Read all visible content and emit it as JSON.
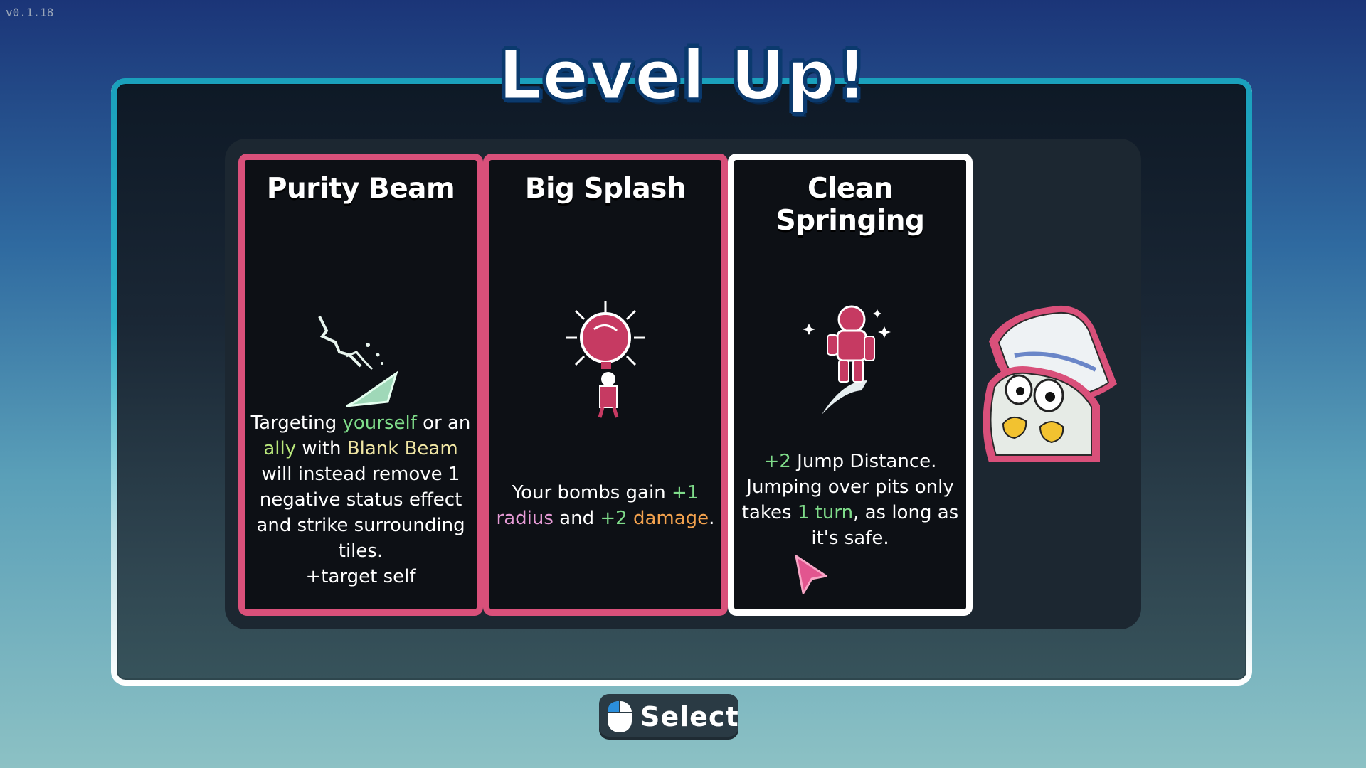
{
  "version": "v0.1.18",
  "title": "Level Up!",
  "cards": [
    {
      "name": "Purity Beam",
      "icon": "beam-icon",
      "desc": [
        {
          "text": "Targeting ",
          "c": ""
        },
        {
          "text": "yourself",
          "c": "green"
        },
        {
          "text": " or an ",
          "c": ""
        },
        {
          "text": "ally",
          "c": "lime"
        },
        {
          "text": " with ",
          "c": ""
        },
        {
          "text": "Blank Beam",
          "c": "cream"
        },
        {
          "text": " will instead remove 1 negative status effect and strike surrounding tiles.",
          "c": ""
        }
      ],
      "extra": "+target self",
      "selected": false
    },
    {
      "name": "Big Splash",
      "icon": "bomb-icon",
      "desc": [
        {
          "text": "Your bombs gain ",
          "c": ""
        },
        {
          "text": "+1 ",
          "c": "green"
        },
        {
          "text": "radius",
          "c": "pink"
        },
        {
          "text": " and ",
          "c": ""
        },
        {
          "text": "+2 ",
          "c": "green"
        },
        {
          "text": "damage",
          "c": "orange"
        },
        {
          "text": ".",
          "c": ""
        }
      ],
      "selected": false
    },
    {
      "name": "Clean Springing",
      "icon": "spring-jump-icon",
      "desc": [
        {
          "text": "+2",
          "c": "green"
        },
        {
          "text": " Jump Distance. Jumping over pits only takes ",
          "c": ""
        },
        {
          "text": "1 turn",
          "c": "green"
        },
        {
          "text": ", as long as it's safe.",
          "c": ""
        }
      ],
      "selected": true
    }
  ],
  "select_label": "Select",
  "colors": {
    "card_border": "#d9507a",
    "card_selected_border": "#ffffff",
    "frame_top": "#1aa0bc",
    "panel": "#1c2731"
  }
}
